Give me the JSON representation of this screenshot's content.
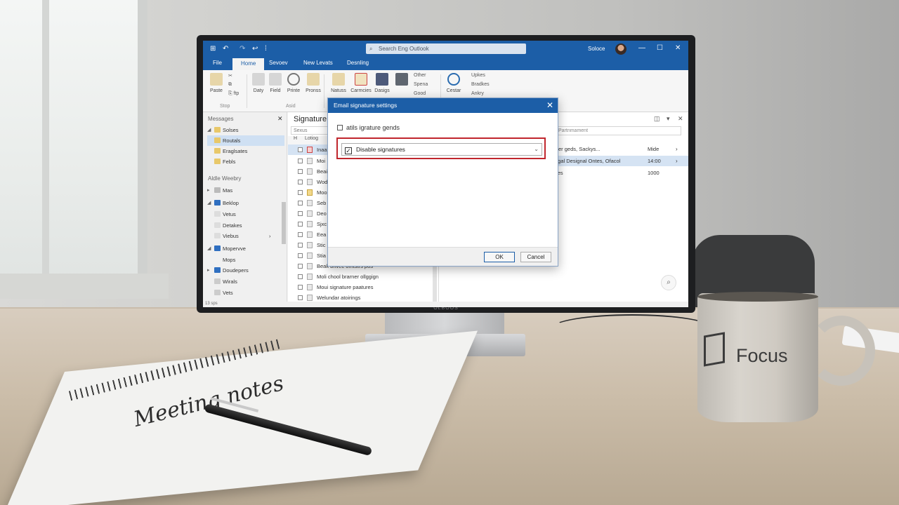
{
  "outlook": {
    "search_placeholder": "Search Eng Outlook",
    "user_name": "Soloce",
    "tabs": [
      "File",
      "Home",
      "Sevoev",
      "New Levats",
      "Desnling"
    ],
    "ribbon": {
      "buttons": [
        "Paste",
        "Daty",
        "Field",
        "Printe",
        "Pronss",
        "Natuss",
        "Carmcies",
        "Dasigs",
        "Cestar"
      ],
      "small_left": [
        "✂",
        "⧉",
        "⎘ ftp"
      ],
      "small_mid": [
        "Other",
        "Spena",
        "Good"
      ],
      "small_right": [
        "Upkes",
        "Bradkes",
        "Ankry"
      ],
      "group_labels": [
        "Stop",
        "Asid"
      ]
    },
    "folders": {
      "header": "Messages",
      "items": [
        "Solses",
        "Routals",
        "Eraglsates",
        "Febls"
      ],
      "header2": "Aldle Weebry",
      "items2": [
        "Mas",
        "Beklop",
        "Vetus",
        "Detakes",
        "Viebus",
        "Mopervve",
        "Mops",
        "Doudepers",
        "Wirals",
        "Vets"
      ],
      "status": "13 sps"
    },
    "message_list": {
      "title": "Signature c",
      "filter": "Sexus",
      "col_h": "H",
      "col_name": "Lotiog",
      "rows": [
        "Inaa",
        "Moi",
        "Beai",
        "Wod",
        "Moo",
        "Seb",
        "Deo",
        "Sjxc",
        "Eea",
        "Stic",
        "Stia",
        "Beak brivec omtstrs pos",
        "Moli chool brarner ollggign",
        "Moui signature paatures",
        "Welundar atoirings"
      ]
    },
    "reading_pane": {
      "search_field": "Partnmament",
      "rows": [
        {
          "text": "fatier geds, Sackys...",
          "value": "Mide"
        },
        {
          "text": "Sagal Designal Ontes, Ofacol",
          "value": "14:00"
        },
        {
          "text": "tures",
          "value": "1000"
        }
      ]
    },
    "dialog": {
      "title": "Email signature settings",
      "option1": "atils igrature gends",
      "option2": "Disable signatures",
      "option2_checked": true,
      "ok": "OK",
      "cancel": "Cancel"
    }
  },
  "monitor_brand": "OLBOOS",
  "notebook_text": "Meeting notes",
  "mug_text": "Focus",
  "colors": {
    "accent": "#1c5ea7",
    "highlight": "#c0262d"
  }
}
